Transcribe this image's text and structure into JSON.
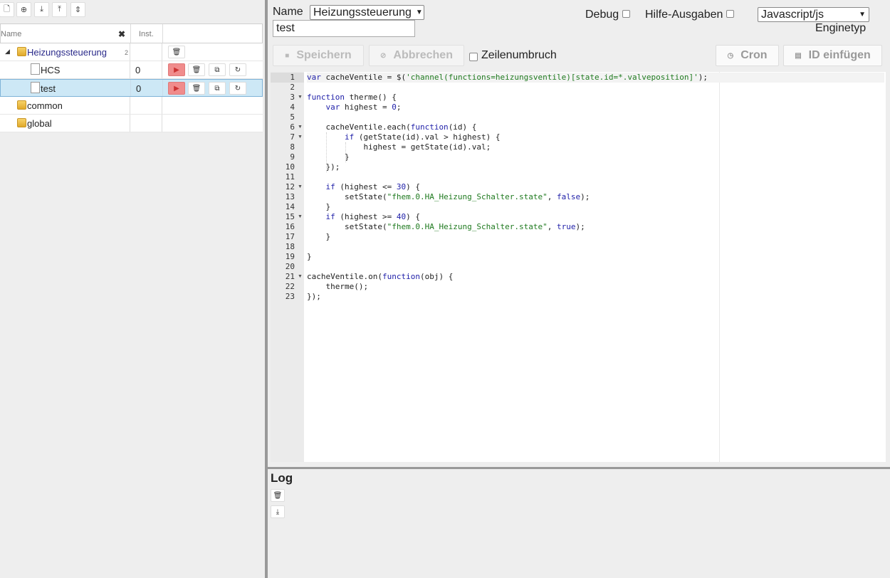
{
  "left_toolbar": [
    {
      "name": "new-script-icon",
      "glyph": "🗋"
    },
    {
      "name": "add-folder-icon",
      "glyph": "⊕"
    },
    {
      "name": "import-icon",
      "glyph": "⤓"
    },
    {
      "name": "collapse-all-icon",
      "glyph": "⤒"
    },
    {
      "name": "expand-all-icon",
      "glyph": "⇕"
    }
  ],
  "tree": {
    "header": {
      "name": "Name",
      "inst": "Inst."
    },
    "rows": [
      {
        "label": "Heizungssteuerung",
        "type": "folder",
        "count": "2",
        "inst": ""
      },
      {
        "label": "HCS",
        "type": "file",
        "inst": "0"
      },
      {
        "label": "test",
        "type": "file",
        "inst": "0"
      },
      {
        "label": "common",
        "type": "folder",
        "inst": ""
      },
      {
        "label": "global",
        "type": "folder",
        "inst": ""
      }
    ]
  },
  "script_header": {
    "name_label": "Name",
    "name_select": "Heizungssteuerung",
    "name_value": "test",
    "debug_label": "Debug",
    "help_label": "Hilfe-Ausgaben",
    "engine_select": "Javascript/js",
    "engine_label": "Enginetyp"
  },
  "actions": {
    "save": "Speichern",
    "cancel": "Abbrechen",
    "wrap": "Zeilenumbruch",
    "cron": "Cron",
    "insert_id": "ID einfügen"
  },
  "code_lines": [
    "var cacheVentile = $('channel(functions=heizungsventile)[state.id=*.valveposition]');",
    "",
    "function therme() {",
    "    var highest = 0;",
    "",
    "    cacheVentile.each(function(id) {",
    "        if (getState(id).val > highest) {",
    "            highest = getState(id).val;",
    "        }",
    "    });",
    "",
    "    if (highest <= 30) {",
    "        setState(\"fhem.0.HA_Heizung_Schalter.state\", false);",
    "    }",
    "    if (highest >= 40) {",
    "        setState(\"fhem.0.HA_Heizung_Schalter.state\", true);",
    "    }",
    "",
    "}",
    "",
    "cacheVentile.on(function(obj) {",
    "    therme();",
    "});"
  ],
  "fold_lines": [
    3,
    6,
    7,
    12,
    15,
    21
  ],
  "active_line": 1,
  "log": {
    "title": "Log"
  }
}
